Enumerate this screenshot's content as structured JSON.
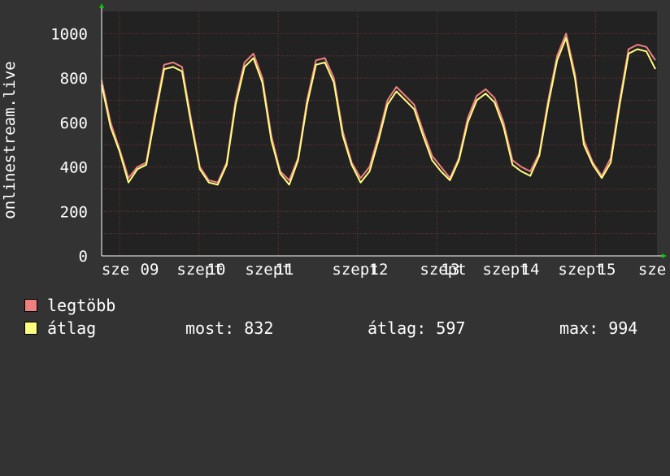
{
  "chart_data": {
    "type": "line",
    "ylabel": "onlinestream.live",
    "ylim": [
      0,
      1100
    ],
    "yticks": [
      0,
      200,
      400,
      600,
      800,
      1000
    ],
    "grid": true,
    "x_tick_labels": [
      "sze",
      "09",
      "szept",
      "10",
      "szept",
      "11",
      "szept",
      "12",
      "szept",
      "13",
      "szept",
      "14",
      "szept",
      "15",
      "sze"
    ],
    "x": [
      0,
      0.12,
      0.25,
      0.38,
      0.5,
      0.62,
      0.75,
      0.88,
      1.0,
      1.12,
      1.25,
      1.38,
      1.5,
      1.62,
      1.75,
      1.88,
      2.0,
      2.12,
      2.25,
      2.38,
      2.5,
      2.62,
      2.75,
      2.88,
      3.0,
      3.12,
      3.25,
      3.38,
      3.5,
      3.62,
      3.75,
      3.88,
      4.0,
      4.12,
      4.25,
      4.38,
      4.5,
      4.62,
      4.75,
      4.88,
      5.0,
      5.12,
      5.25,
      5.38,
      5.5,
      5.62,
      5.75,
      5.88,
      6.0,
      6.12,
      6.25,
      6.38,
      6.5,
      6.62,
      6.75,
      6.88,
      7.0
    ],
    "series": [
      {
        "name": "legtöbb",
        "color": "#f08080",
        "values": [
          790,
          600,
          480,
          350,
          400,
          420,
          650,
          860,
          870,
          850,
          620,
          400,
          340,
          330,
          420,
          700,
          870,
          910,
          800,
          540,
          380,
          340,
          440,
          700,
          880,
          890,
          800,
          560,
          420,
          350,
          400,
          540,
          700,
          760,
          720,
          680,
          560,
          450,
          400,
          350,
          440,
          620,
          720,
          750,
          710,
          600,
          430,
          400,
          380,
          460,
          700,
          900,
          1000,
          820,
          520,
          420,
          360,
          440,
          700,
          930,
          950,
          940,
          880
        ]
      },
      {
        "name": "átlag",
        "color": "#ffff80",
        "values": [
          770,
          580,
          470,
          330,
          390,
          410,
          630,
          840,
          850,
          830,
          600,
          390,
          330,
          320,
          410,
          680,
          850,
          890,
          780,
          520,
          370,
          320,
          430,
          680,
          860,
          870,
          780,
          540,
          410,
          330,
          380,
          520,
          680,
          740,
          700,
          660,
          540,
          430,
          380,
          340,
          430,
          600,
          700,
          730,
          690,
          580,
          410,
          380,
          360,
          450,
          680,
          880,
          980,
          800,
          500,
          410,
          350,
          420,
          680,
          910,
          930,
          920,
          840
        ]
      }
    ]
  },
  "legend": {
    "series": [
      {
        "label": "legtöbb",
        "color": "#f08080"
      },
      {
        "label": "átlag",
        "color": "#ffff80"
      }
    ],
    "stats": {
      "now": "most: 832",
      "avg": "átlag: 597",
      "max": "max: 994"
    }
  },
  "colors": {
    "background": "#333333",
    "plot_background": "#222222",
    "grid": "#7a3a3a",
    "axis": "#ffffff",
    "arrow": "#00cc00"
  }
}
